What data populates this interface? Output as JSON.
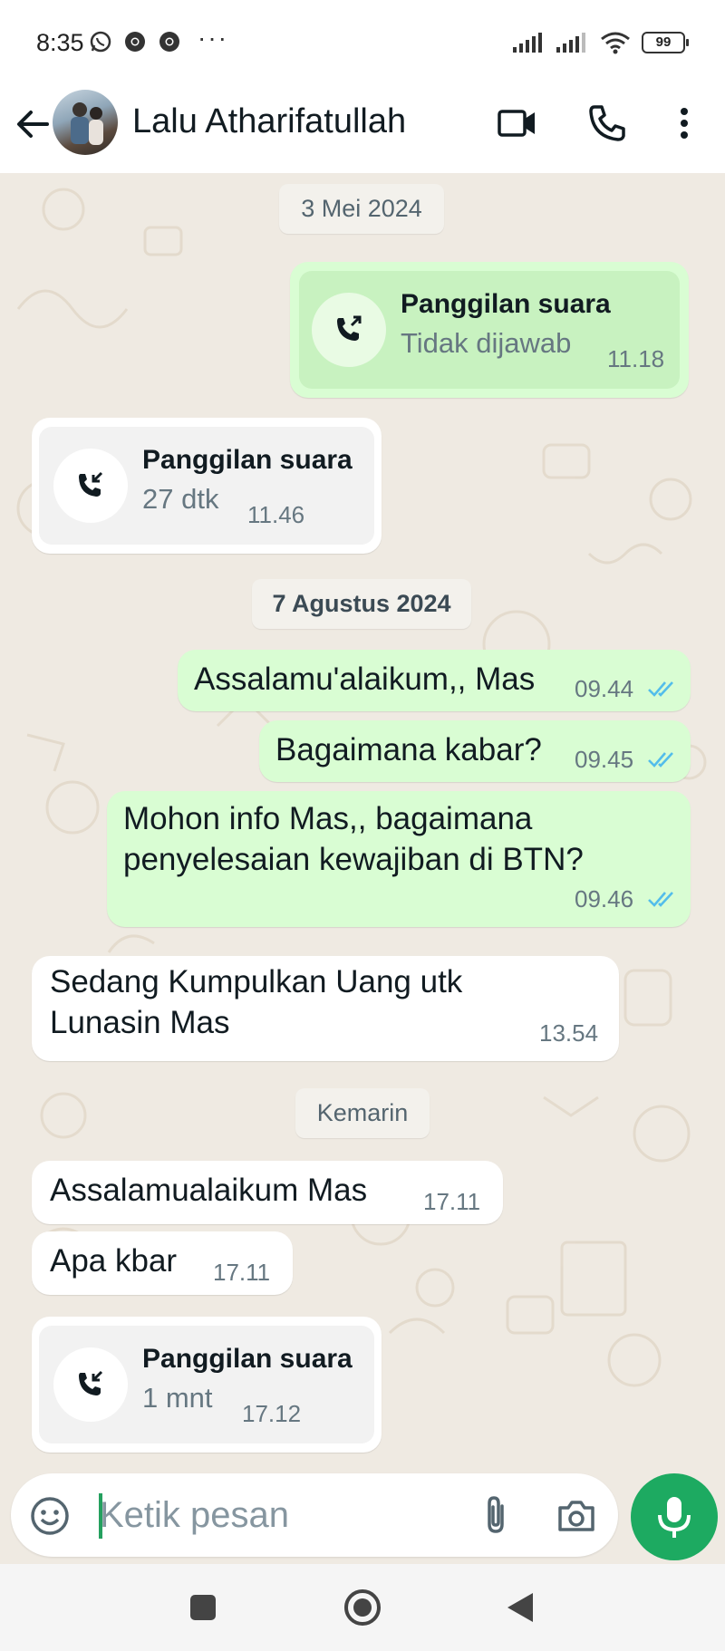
{
  "status_bar": {
    "time": "8:35",
    "dots": "···",
    "battery": "99"
  },
  "header": {
    "contact_name": "Lalu Atharifatullah"
  },
  "dates": {
    "d1": "3 Mei 2024",
    "d2": "7 Agustus 2024",
    "d3": "Kemarin"
  },
  "messages": {
    "call1": {
      "title": "Panggilan suara",
      "sub": "Tidak dijawab",
      "time": "11.18"
    },
    "call2": {
      "title": "Panggilan suara",
      "sub": "27 dtk",
      "time": "11.46"
    },
    "m1": {
      "text": "Assalamu'alaikum,, Mas",
      "time": "09.44"
    },
    "m2": {
      "text": "Bagaimana kabar?",
      "time": "09.45"
    },
    "m3": {
      "line1": "Mohon info Mas,, bagaimana",
      "line2": "penyelesaian kewajiban di BTN?",
      "time": "09.46"
    },
    "m4": {
      "line1": "Sedang Kumpulkan Uang utk",
      "line2": "Lunasin Mas",
      "time": "13.54"
    },
    "m5": {
      "text": "Assalamualaikum Mas",
      "time": "17.11"
    },
    "m6": {
      "text": "Apa kbar",
      "time": "17.11"
    },
    "call3": {
      "title": "Panggilan suara",
      "sub": "1 mnt",
      "time": "17.12"
    }
  },
  "input": {
    "placeholder": "Ketik pesan"
  },
  "colors": {
    "outgoing": "#d9fdd3",
    "incoming": "#ffffff",
    "accent": "#1daa61",
    "read_ticks": "#53bdeb",
    "wallpaper": "#efeae2"
  },
  "icons": [
    "whatsapp-icon",
    "chrome-icon",
    "signal-icon",
    "wifi-icon",
    "battery-icon",
    "back-arrow-icon",
    "video-call-icon",
    "voice-call-icon",
    "more-vert-icon",
    "call-outgoing-icon",
    "call-incoming-icon",
    "double-check-icon",
    "emoji-icon",
    "attach-icon",
    "camera-icon",
    "mic-icon",
    "nav-recents-icon",
    "nav-home-icon",
    "nav-back-icon"
  ]
}
